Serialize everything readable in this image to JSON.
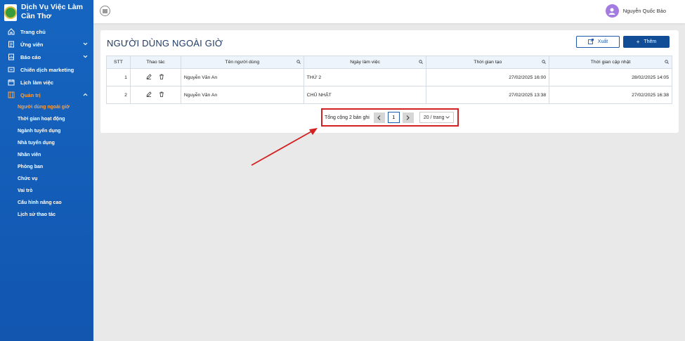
{
  "brand": {
    "name": "Dịch Vụ Việc Làm Cần Thơ"
  },
  "sidebar": {
    "items": [
      {
        "label": "Trang chủ",
        "icon": "home-icon"
      },
      {
        "label": "Ứng viên",
        "icon": "candidate-icon",
        "has_children": true
      },
      {
        "label": "Báo cáo",
        "icon": "report-icon",
        "has_children": true
      },
      {
        "label": "Chiến dịch marketing",
        "icon": "campaign-icon"
      },
      {
        "label": "Lịch làm việc",
        "icon": "calendar-icon"
      },
      {
        "label": "Quản trị",
        "icon": "admin-icon",
        "has_children": true,
        "expanded": true
      }
    ],
    "sub_items": [
      "Người dùng ngoài giờ",
      "Thời gian hoạt động",
      "Ngành tuyển dụng",
      "Nhà tuyển dụng",
      "Nhân viên",
      "Phòng ban",
      "Chức vụ",
      "Vai trò",
      "Cấu hình nâng cao",
      "Lịch sử thao tác"
    ],
    "active_sub": "Người dùng ngoài giờ"
  },
  "header": {
    "user_name": "Nguyễn Quốc Bảo"
  },
  "page": {
    "title": "NGƯỜI DÙNG NGOÀI GIỜ",
    "export_label": "Xuất",
    "add_label": "Thêm"
  },
  "table": {
    "columns": [
      "STT",
      "Thao tác",
      "Tên người dùng",
      "Ngày làm việc",
      "Thời gian tạo",
      "Thời gian cập nhật"
    ],
    "rows": [
      {
        "stt": "1",
        "name": "Nguyễn Văn An",
        "day": "THỨ 2",
        "created": "27/02/2025 16:00",
        "updated": "28/02/2025 14:05"
      },
      {
        "stt": "2",
        "name": "Nguyễn Văn An",
        "day": "CHỦ NHẬT",
        "created": "27/02/2025 13:38",
        "updated": "27/02/2025 16:38"
      }
    ]
  },
  "pagination": {
    "total_text": "Tổng cộng 2 bản ghi",
    "current_page": "1",
    "page_size": "20 / trang"
  },
  "colors": {
    "sidebar": "#1565c0",
    "accent": "#114d96",
    "active": "#ffa040",
    "highlight": "#d32020"
  }
}
